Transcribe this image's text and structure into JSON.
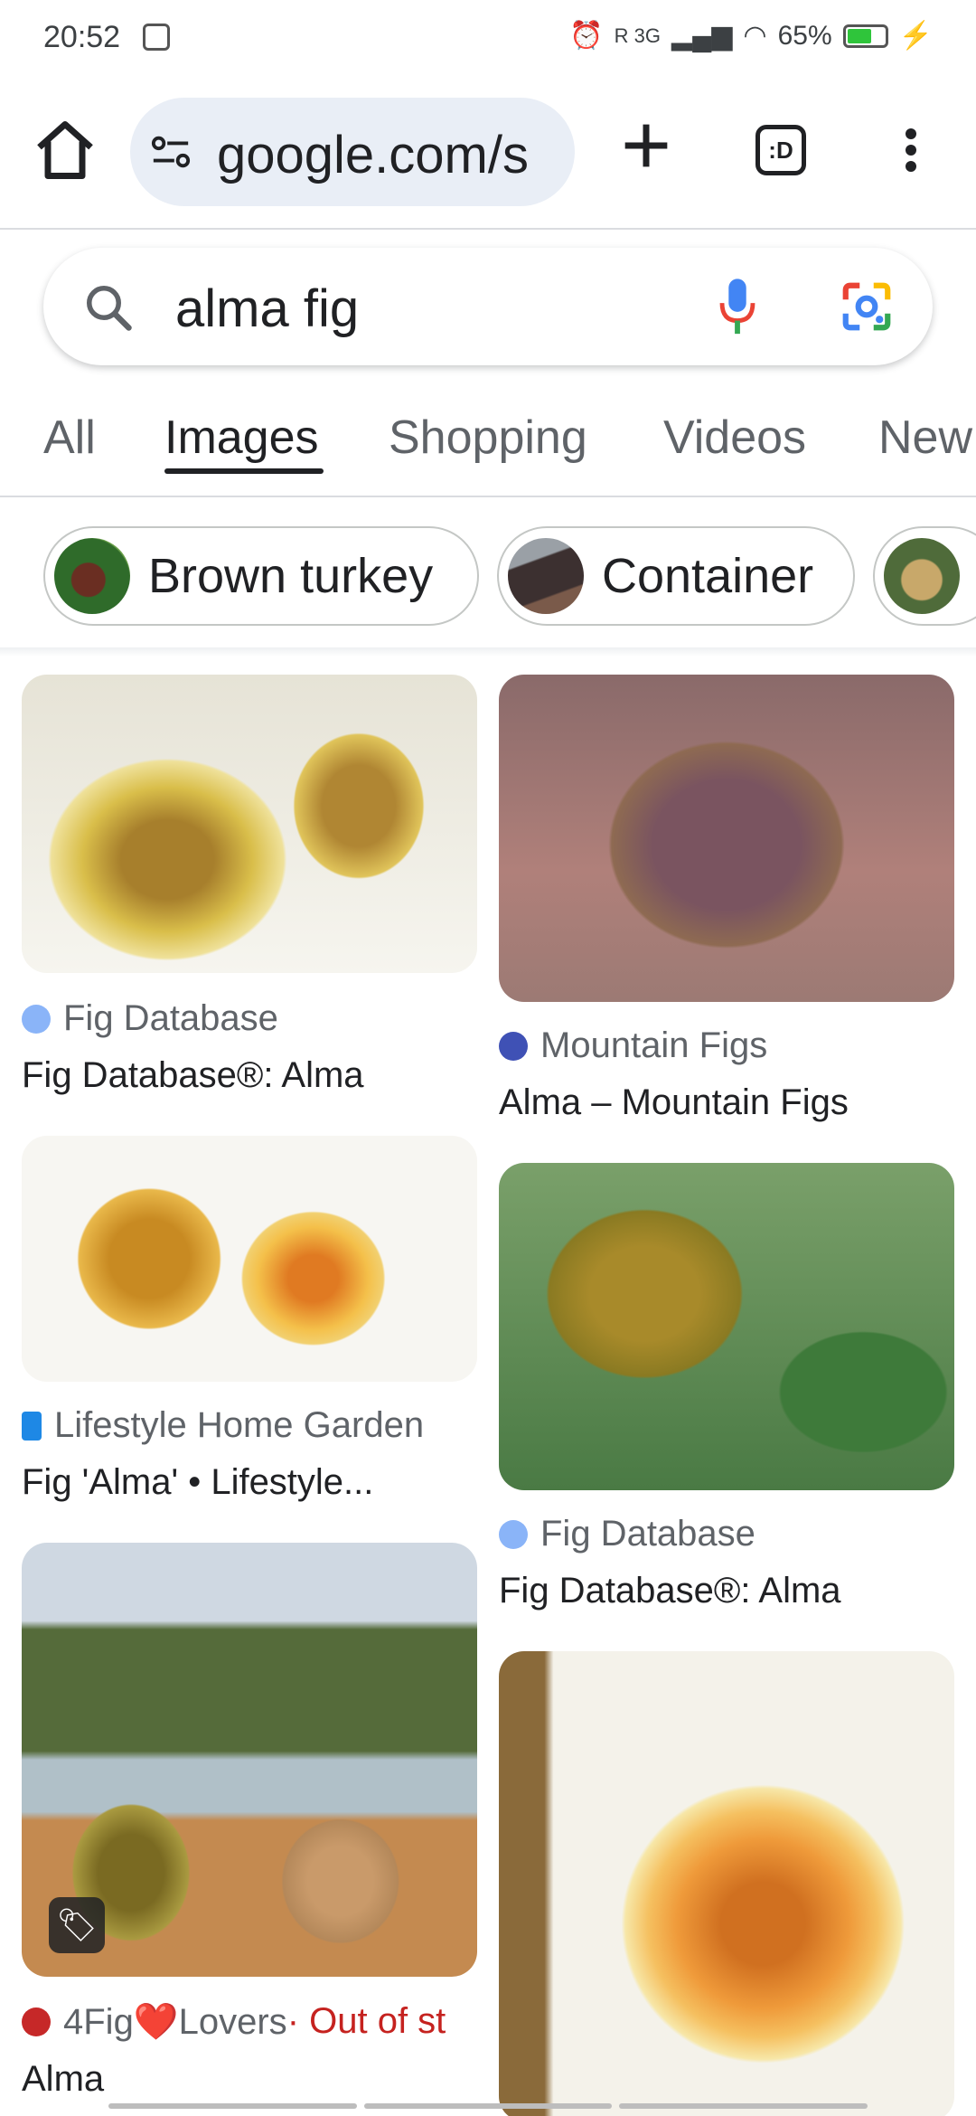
{
  "status_bar": {
    "time": "20:52",
    "network": "R 3G",
    "battery": "65%",
    "battery_level": 0.65
  },
  "browser": {
    "url": "google.com/s",
    "tabs_label": ":D"
  },
  "search": {
    "query": "alma fig"
  },
  "filter_tabs": [
    {
      "label": "All",
      "active": false
    },
    {
      "label": "Images",
      "active": true
    },
    {
      "label": "Shopping",
      "active": false
    },
    {
      "label": "Videos",
      "active": false
    },
    {
      "label": "New",
      "active": false
    }
  ],
  "chips": [
    {
      "label": "Brown turkey"
    },
    {
      "label": "Container"
    },
    {
      "label": ""
    }
  ],
  "results": [
    {
      "source": "Fig Database",
      "title": "Fig Database®: Alma",
      "favicon_color": "#8ab4f8"
    },
    {
      "source": "Mountain Figs",
      "title": "Alma – Mountain Figs",
      "favicon_color": "#3f51b5"
    },
    {
      "source": "Lifestyle Home Garden",
      "title": "Fig 'Alma' • Lifestyle...",
      "favicon_color": "#1e88e5"
    },
    {
      "source": "Fig Database",
      "title": "Fig Database®: Alma",
      "favicon_color": "#8ab4f8"
    },
    {
      "source": "4Fig❤️Lovers",
      "source_suffix": " · Out of st",
      "title": "Alma",
      "favicon_color": "#c62828"
    },
    {
      "source": "",
      "title": ""
    }
  ],
  "colors": {
    "accent": "#202124",
    "url_bg": "#e9eef6",
    "out_of_stock": "#c5221f"
  }
}
